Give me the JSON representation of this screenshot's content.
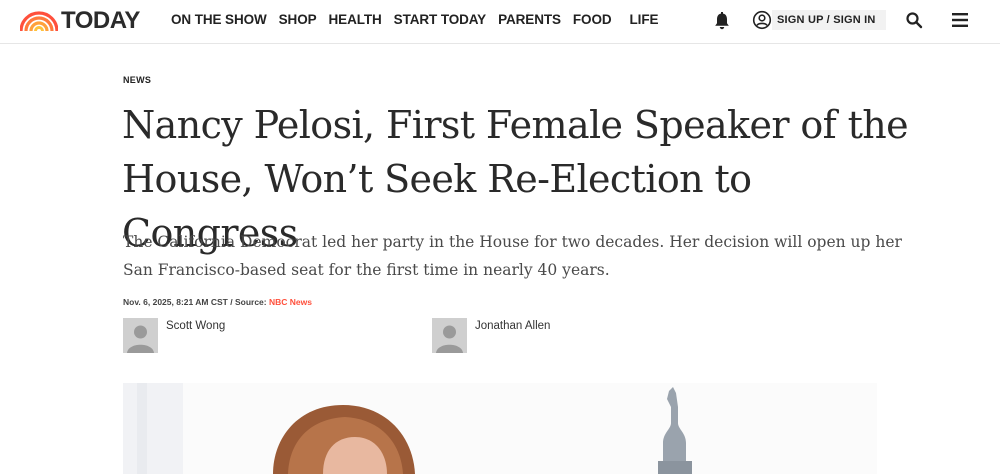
{
  "brand": {
    "name": "TODAY",
    "accent": "#ff503c"
  },
  "nav": {
    "items": [
      "ON THE SHOW",
      "SHOP",
      "HEALTH",
      "START TODAY",
      "PARENTS",
      "FOOD",
      "LIFE"
    ]
  },
  "header": {
    "signup_label": "SIGN UP / SIGN IN"
  },
  "article": {
    "category": "NEWS",
    "headline": "Nancy Pelosi, First Female Speaker of the House, Won’t Seek Re-Election to Congress",
    "dek": "The California Democrat led her party in the House for two decades. Her decision will open up her San Francisco-based seat for the first time in nearly 40 years.",
    "timestamp": "Nov. 6, 2025, 8:21 AM CST / Source: ",
    "source": "NBC News",
    "authors": [
      {
        "name": "Scott Wong"
      },
      {
        "name": "Jonathan Allen"
      }
    ]
  },
  "icons": {
    "logo": "rainbow-logo-icon",
    "bell": "bell-icon",
    "user": "user-circle-icon",
    "search": "search-icon",
    "menu": "hamburger-menu-icon",
    "avatar": "avatar-placeholder-icon"
  },
  "colors": {
    "text": "#2a2a2a",
    "source_link": "#ff503c",
    "divider": "#e6e6e6"
  }
}
